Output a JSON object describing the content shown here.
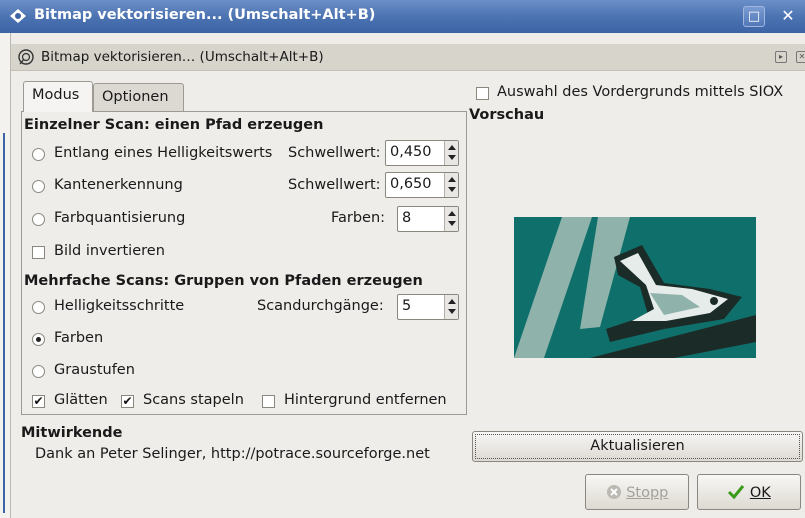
{
  "window": {
    "title": "Bitmap vektorisieren... (Umschalt+Alt+B)",
    "maximize_glyph": "□",
    "close_glyph": "✕"
  },
  "dock": {
    "title": "Bitmap vektorisieren… (Umschalt+Alt+B)",
    "menu_glyph": "▸",
    "close_glyph": "✕"
  },
  "tabs": [
    {
      "label": "Modus",
      "active": true
    },
    {
      "label": "Optionen",
      "active": false
    }
  ],
  "single_scan": {
    "heading": "Einzelner Scan: einen Pfad erzeugen",
    "brightness": {
      "label": "Entlang eines Helligkeitswerts",
      "param_label": "Schwellwert:",
      "value": "0,450",
      "selected": false
    },
    "edge": {
      "label": "Kantenerkennung",
      "param_label": "Schwellwert:",
      "value": "0,650",
      "selected": false
    },
    "color_quant": {
      "label": "Farbquantisierung",
      "param_label": "Farben:",
      "value": "8",
      "selected": false
    },
    "invert": {
      "label": "Bild invertieren",
      "checked": false
    }
  },
  "multi_scan": {
    "heading": "Mehrfache Scans: Gruppen von Pfaden erzeugen",
    "brightness_steps": {
      "label": "Helligkeitsschritte",
      "param_label": "Scandurchgänge:",
      "value": "5",
      "selected": false
    },
    "colors": {
      "label": "Farben",
      "selected": true
    },
    "grays": {
      "label": "Graustufen",
      "selected": false
    },
    "smooth": {
      "label": "Glätten",
      "checked": true
    },
    "stack": {
      "label": "Scans stapeln",
      "checked": true
    },
    "remove_bg": {
      "label": "Hintergrund entfernen",
      "checked": false
    }
  },
  "credits": {
    "heading": "Mitwirkende",
    "text": "Dank an Peter Selinger, http://potrace.sourceforge.net"
  },
  "siox": {
    "label": "Auswahl des Vordergrunds mittels SIOX",
    "checked": false
  },
  "preview": {
    "heading": "Vorschau"
  },
  "buttons": {
    "refresh": "Aktualisieren",
    "stop": "Stopp",
    "ok": "OK",
    "stop_mnemonic": "S",
    "ok_mnemonic": "O"
  },
  "colors": {
    "title_bar": "#4a71b0",
    "preview_bg": "#0f6f6a",
    "preview_light": "#8fb3ab",
    "preview_dark": "#1b2b28",
    "ok_check": "#3a9a1a"
  },
  "check_mark": "✔"
}
